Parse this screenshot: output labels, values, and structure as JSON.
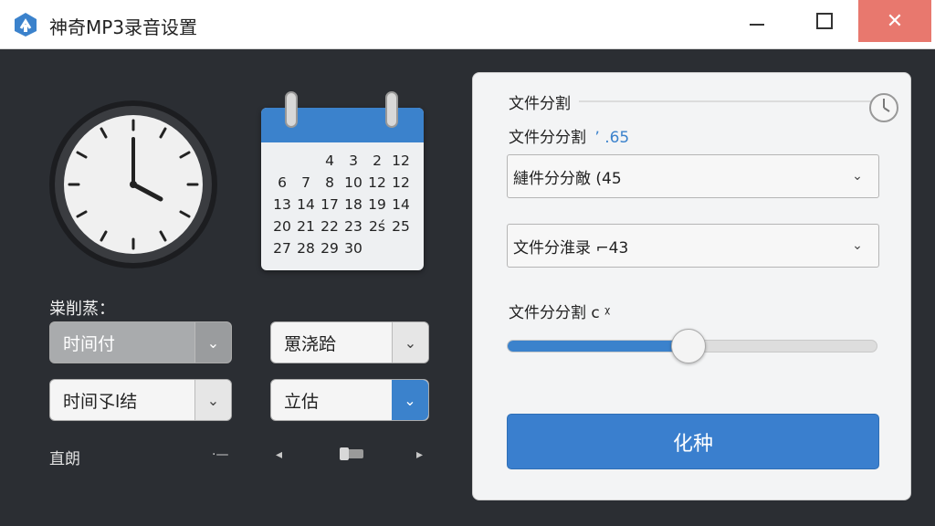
{
  "window": {
    "title": "神奇MP3录音设置",
    "min_icon": "minimize-icon",
    "max_icon": "maximize-icon",
    "close_symbol": "✕"
  },
  "calendar": {
    "rows": [
      [
        "",
        "",
        "4",
        "3",
        "2",
        "12"
      ],
      [
        "6",
        "7",
        "8",
        "10",
        "12",
        "12"
      ],
      [
        "13",
        "14",
        "17",
        "18",
        "19",
        "14"
      ],
      [
        "20",
        "21",
        "22",
        "23",
        "2ś",
        "25"
      ],
      [
        "27",
        "28",
        "29",
        "30",
        "",
        ""
      ]
    ]
  },
  "left": {
    "section_label": "粜削蒸：",
    "dropdown1": "时间付",
    "dropdown2": "罳浇跲",
    "dropdown3": "时间孓l结",
    "dropdown4": "立估",
    "bottom_label": "直朗",
    "ctrl1": "·—",
    "ctrl2": "◂",
    "ctrl4": "▸"
  },
  "panel": {
    "header": "文件分割",
    "line2_label": "文件分分割",
    "line2_value": "ʼ .65",
    "select1": "縺件分分敵 (45",
    "select2": "文件分淮录 ⌐43",
    "slider_label": "文件分分割 ᴄ ᵡ",
    "slider_value": 0.49,
    "button_label": "化种"
  },
  "colors": {
    "accent": "#3b82cc",
    "background": "#2b2e33",
    "close_button": "#e8786e",
    "panel": "#f3f4f5"
  }
}
